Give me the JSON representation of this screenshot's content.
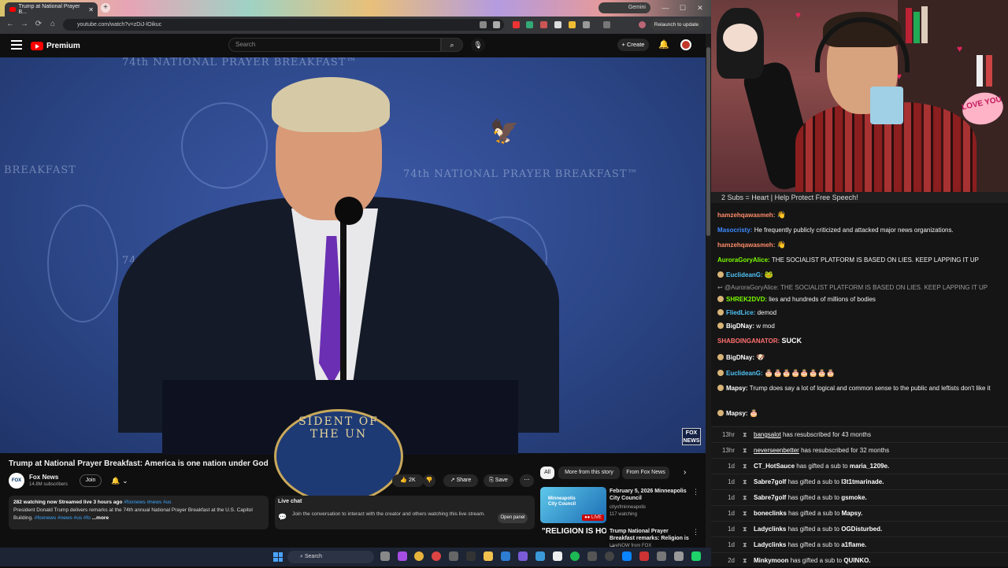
{
  "browser": {
    "tab_title": "Trump at National Prayer B...",
    "gemini_label": "Gemini",
    "url": "youtube.com/watch?v=zDiJ-lOikuc",
    "relaunch_label": "Relaunch to update"
  },
  "youtube": {
    "logo_text": "Premium",
    "search_placeholder": "Search",
    "create_label": "Create"
  },
  "video_overlay": {
    "bg_text_1": "74th NATIONAL PRAYER BREAKFAST™",
    "bg_text_2": "74th NATIONAL PRAYER BREAKFAST™",
    "bg_text_3": "BREAKFAST",
    "bg_text_4": "74th NA",
    "podium_text": "SIDENT OF THE UN",
    "fox_bug": "FOX NEWS"
  },
  "video": {
    "title": "Trump at National Prayer Breakfast: America is one nation under God",
    "channel_name": "Fox News",
    "channel_subs": "14.8M subscribers",
    "join_label": "Join",
    "like_count": "2K",
    "share_label": "Share",
    "save_label": "Save",
    "desc_meta": "282 watching now  Streamed live 3 hours ago",
    "desc_tags": "#foxnews #news #us",
    "desc_text": "President Donald Trump delivers remarks at the 74th annual National Prayer Breakfast at the U.S. Capitol Building.",
    "desc_tags2": "#foxnews #news #us #fo",
    "desc_more": "...more"
  },
  "livechat": {
    "title": "Live chat",
    "text": "Join the conversation to interact with the creator and others watching this live stream.",
    "open_label": "Open panel"
  },
  "chips": [
    "All",
    "More from this story",
    "From Fox News"
  ],
  "related": [
    {
      "title": "February 5, 2026 Minneapolis City Council",
      "channel": "cityofminneapolis",
      "meta": "117 watching",
      "thumb_label": "Minneapolis City Council",
      "live_badge": "LIVE"
    },
    {
      "title": "Trump National Prayer Breakfast remarks: Religion is ...",
      "channel": "LiveNOW from FOX",
      "meta": "",
      "thumb_label": "\"RELIGION IS HOT\""
    }
  ],
  "taskbar": {
    "search_label": "Search"
  },
  "stream": {
    "love_sign": "LOVE YOU",
    "sub_banner": "2 Subs = Heart | Help Protect Free Speech!"
  },
  "chat": [
    {
      "user": "hamzehqawasmeh:",
      "color": "#ff8c69",
      "text": "",
      "emote": "👋"
    },
    {
      "user": "Masocristy:",
      "color": "#3d8bff",
      "text": "He frequently publicly criticized and attacked major news organizations.",
      "emote": ""
    },
    {
      "user": "hamzehqawasmeh:",
      "color": "#ff8c69",
      "text": "",
      "emote": "👋"
    },
    {
      "user": "AuroraGoryAlice:",
      "color": "#7cfc00",
      "text": "THE SOCIALIST PLATFORM IS BASED ON LIES. KEEP LAPPING IT UP",
      "emote": ""
    },
    {
      "user": "EuclideanG:",
      "color": "#4fc3f7",
      "text": "",
      "emote": "🐸"
    },
    {
      "user": "SHREK2DVD:",
      "color": "#7cfc00",
      "text": "lies and hundreds of millions of bodies",
      "emote": ""
    },
    {
      "user": "FliedLice:",
      "color": "#4fc3f7",
      "text": "demod",
      "emote": ""
    },
    {
      "user": "BigDNay:",
      "color": "#ffffff",
      "text": "w mod",
      "emote": ""
    },
    {
      "user": "SHABOINGANATOR:",
      "color": "#ff6f6f",
      "text": "",
      "emote": "SUCK"
    },
    {
      "user": "BigDNay:",
      "color": "#ffffff",
      "text": "",
      "emote": "🐶"
    },
    {
      "user": "EuclideanG:",
      "color": "#4fc3f7",
      "text": "",
      "emote": "🎂🎂🎂🎂🎂🎂🎂🎂"
    },
    {
      "user": "Mapsy:",
      "color": "#ffffff",
      "text": "Trump does say a lot of logical and common sense to the public and leftists don't like it",
      "emote": ""
    },
    {
      "user": "Mapsy:",
      "color": "#ffffff",
      "text": "",
      "emote": "🎂"
    }
  ],
  "chat_reply": "@AuroraGoryAlice: THE SOCIALIST PLATFORM IS BASED ON LIES. KEEP LAPPING IT UP",
  "events": [
    {
      "time": "13hr",
      "name": "bangsalot",
      "text": "has resubscribed for 43 months",
      "target": ""
    },
    {
      "time": "13hr",
      "name": "neverseenbetter",
      "text": "has resubscribed for 32 months",
      "target": ""
    },
    {
      "time": "1d",
      "name": "CT_HotSauce",
      "text": "has gifted a sub to",
      "target": "maria_1209e."
    },
    {
      "time": "1d",
      "name": "Sabre7golf",
      "text": "has gifted a sub to",
      "target": "l3t1tmarinade."
    },
    {
      "time": "1d",
      "name": "Sabre7golf",
      "text": "has gifted a sub to",
      "target": "gsmoke."
    },
    {
      "time": "1d",
      "name": "boneclinks",
      "text": "has gifted a sub to",
      "target": "Mapsy."
    },
    {
      "time": "1d",
      "name": "Ladyclinks",
      "text": "has gifted a sub to",
      "target": "OGDisturbed."
    },
    {
      "time": "1d",
      "name": "Ladyclinks",
      "text": "has gifted a sub to",
      "target": "a1flame."
    },
    {
      "time": "2d",
      "name": "Minkymoon",
      "text": "has gifted a sub to",
      "target": "QUINKO."
    }
  ]
}
